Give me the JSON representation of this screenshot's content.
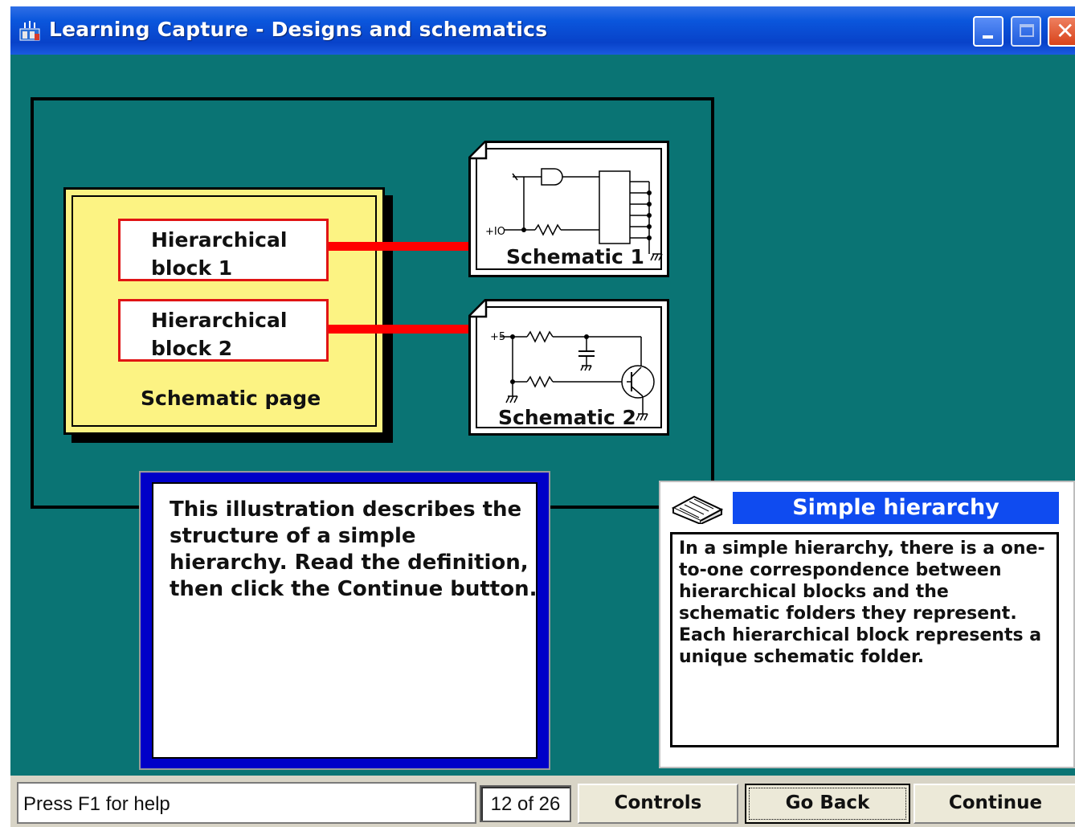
{
  "window": {
    "title": "Learning Capture - Designs and schematics"
  },
  "diagram": {
    "blocks": [
      {
        "label": "Hierarchical block 1"
      },
      {
        "label": "Hierarchical block 2"
      }
    ],
    "page_label": "Schematic page",
    "schematics": [
      {
        "label": "Schematic 1",
        "pin_label": "+IO"
      },
      {
        "label": "Schematic 2",
        "pin_label": "+5"
      }
    ]
  },
  "instruction": {
    "text": "This illustration describes the structure of a simple hierarchy. Read the definition, then click the Continue button."
  },
  "definition": {
    "title": "Simple hierarchy",
    "body": "In a simple hierarchy, there is a one-to-one correspondence between hierarchical blocks and the schematic folders they represent. Each hierarchical block represents a unique schematic folder."
  },
  "statusbar": {
    "help_text": "Press F1 for help",
    "page_counter": "12 of 26",
    "buttons": {
      "controls": "Controls",
      "go_back": "Go Back",
      "continue": "Continue"
    }
  },
  "colors": {
    "background": "#0a7474",
    "title_bar": "#0842c9",
    "page": "#fcf383",
    "block_border": "#e01414",
    "connector": "#ff0000",
    "definition_title": "#0f4bf0",
    "instruction_frame": "#0000c8"
  }
}
